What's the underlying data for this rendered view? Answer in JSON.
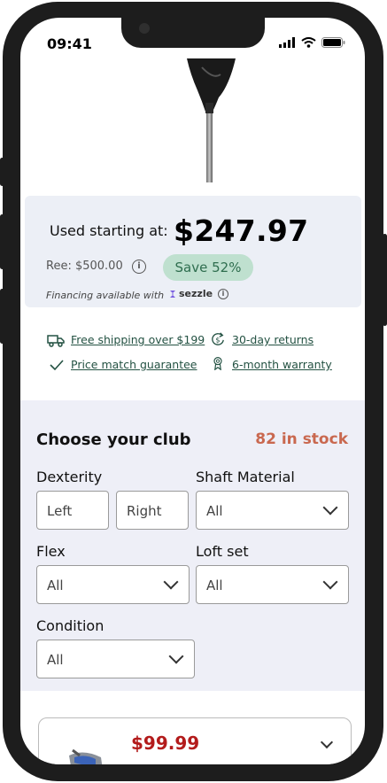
{
  "status_bar": {
    "time": "09:41"
  },
  "price_card": {
    "used_label": "Used starting at:",
    "used_price": "$247.97",
    "ree_price": "Ree: $500.00",
    "save_badge": "Save 52%",
    "financing_text": "Financing available with",
    "financing_brand": "sezzle",
    "info_glyph": "i"
  },
  "perks": [
    {
      "label": "Free shipping over $199",
      "icon": "truck-icon"
    },
    {
      "label": "30-day returns",
      "icon": "returns-icon"
    },
    {
      "label": "Price match guarantee",
      "icon": "check-icon"
    },
    {
      "label": "6-month warranty",
      "icon": "ribbon-icon"
    }
  ],
  "choose": {
    "title": "Choose your club",
    "stock": "82 in stock",
    "dexterity": {
      "label": "Dexterity",
      "left": "Left",
      "right": "Right"
    },
    "shaft_material": {
      "label": "Shaft Material",
      "value": "All"
    },
    "flex": {
      "label": "Flex",
      "value": "All"
    },
    "loft_set": {
      "label": "Loft set",
      "value": "All"
    },
    "condition": {
      "label": "Condition",
      "value": "All"
    }
  },
  "listing": {
    "price": "$99.99"
  },
  "colors": {
    "accent_stock": "#c9684f",
    "save_bg": "#bfe0cf",
    "listing_price": "#b31b1b",
    "perk_link": "#245243"
  }
}
